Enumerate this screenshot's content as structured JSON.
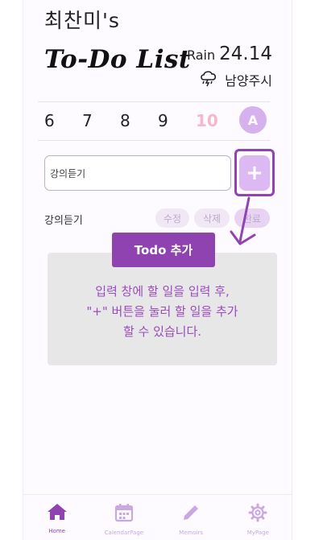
{
  "header": {
    "owner_name": "최찬미's",
    "app_title": "To-Do List"
  },
  "weather": {
    "condition": "Rain",
    "temperature": "24.14",
    "location": "남양주시",
    "icon": "cloud-rain-icon"
  },
  "dates": [
    "6",
    "7",
    "8",
    "9",
    "10"
  ],
  "selected_date": "10",
  "avatar_initial": "A",
  "input": {
    "value": "강의듣기",
    "add_label": "+"
  },
  "todos": [
    {
      "text": "강의듣기",
      "edit_label": "수정",
      "delete_label": "삭제",
      "done_label": "완료"
    }
  ],
  "tooltip": {
    "label": "Todo 추가",
    "line1": "입력 창에 할 일을 입력 후,",
    "line2": "\"+\" 버튼을 눌러 할 일을 추가",
    "line3": "할 수 있습니다."
  },
  "nav": [
    {
      "label": "Home",
      "icon": "home-icon"
    },
    {
      "label": "CalendarPage",
      "icon": "calendar-icon"
    },
    {
      "label": "Memoirs",
      "icon": "pencil-icon"
    },
    {
      "label": "MyPage",
      "icon": "gear-icon"
    }
  ],
  "colors": {
    "accent": "#8e43b0",
    "accent_light": "#dcb9f2",
    "selected_date": "#f4b8c8"
  }
}
